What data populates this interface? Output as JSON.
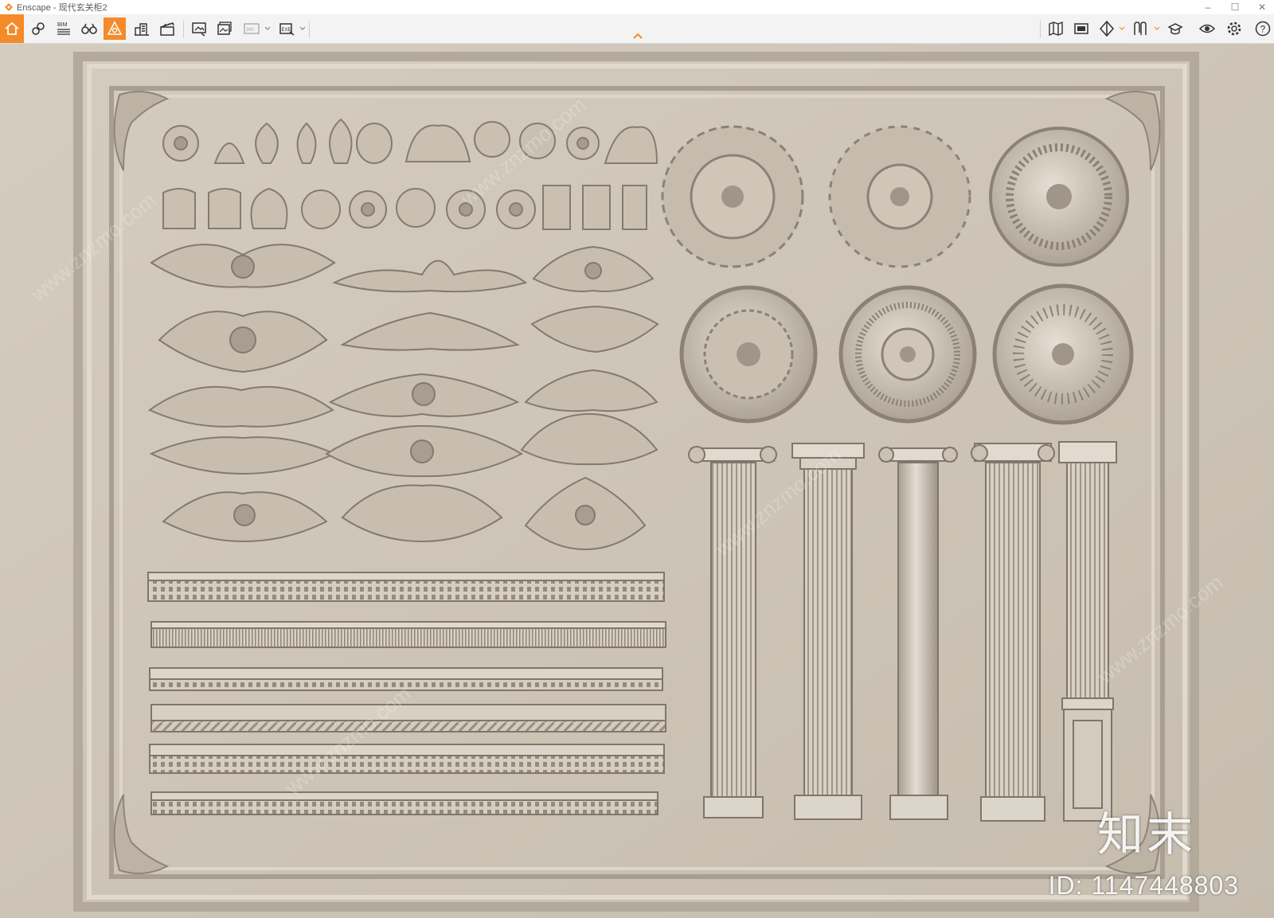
{
  "window": {
    "app_name": "Enscape",
    "title": "Enscape - 现代玄关柜2",
    "controls": [
      "minimize",
      "maximize",
      "close"
    ]
  },
  "toolbar": {
    "left_tools": [
      {
        "name": "home-icon",
        "active": false
      },
      {
        "name": "link-icon",
        "active": false
      },
      {
        "name": "bim-icon",
        "label": "BIM",
        "active": false
      },
      {
        "name": "binoculars-icon",
        "active": false
      },
      {
        "name": "asset-library-icon",
        "active": true
      },
      {
        "name": "buildings-icon",
        "active": false
      },
      {
        "name": "clapper-icon",
        "active": false
      },
      {
        "name": "screenshot-icon",
        "active": false
      },
      {
        "name": "batch-render-icon",
        "active": false
      },
      {
        "name": "panorama-icon",
        "label": "360°",
        "active": false
      },
      {
        "name": "export-exe-icon",
        "label": "EXE",
        "active": false
      }
    ],
    "right_tools": [
      {
        "name": "map-icon"
      },
      {
        "name": "atmosphere-icon"
      },
      {
        "name": "section-icon"
      },
      {
        "name": "materials-icon"
      },
      {
        "name": "cap-icon"
      },
      {
        "name": "eye-icon"
      },
      {
        "name": "settings-icon"
      },
      {
        "name": "help-icon"
      }
    ],
    "accent_color": "#f58a2a",
    "collapse_icon": "chevron-up-icon"
  },
  "viewport": {
    "scene": "classical plaster moulding catalogue: corbels, appliqués, medallions, cornices and columns on a framed wall panel",
    "wall_color": "#cfc6b8"
  },
  "watermark": {
    "brand": "知末",
    "id_text": "ID: 1147448803",
    "tile_text": "www.znzmo.com"
  }
}
